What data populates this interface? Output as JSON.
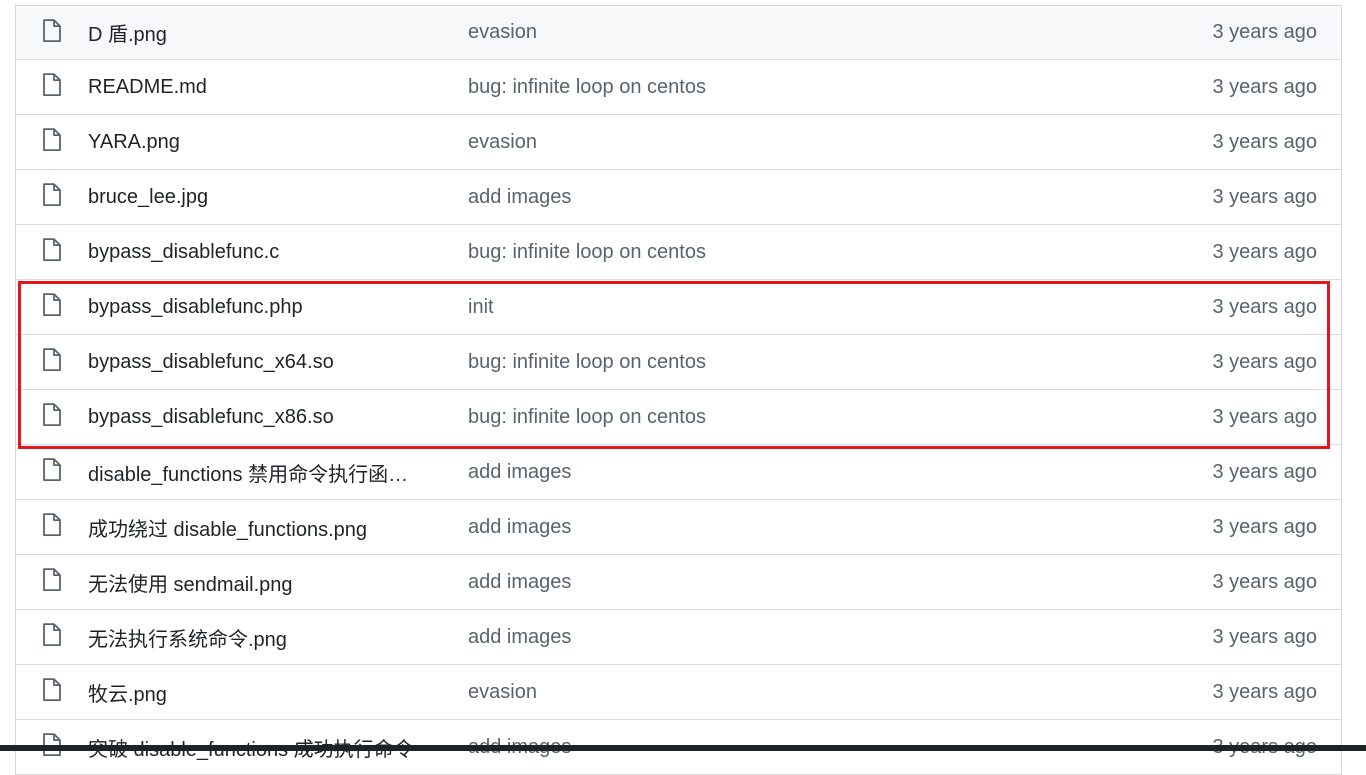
{
  "files": [
    {
      "name": "D 盾.png",
      "message": "evasion",
      "age": "3 years ago"
    },
    {
      "name": "README.md",
      "message": "bug: infinite loop on centos",
      "age": "3 years ago"
    },
    {
      "name": "YARA.png",
      "message": "evasion",
      "age": "3 years ago"
    },
    {
      "name": "bruce_lee.jpg",
      "message": "add images",
      "age": "3 years ago"
    },
    {
      "name": "bypass_disablefunc.c",
      "message": "bug: infinite loop on centos",
      "age": "3 years ago"
    },
    {
      "name": "bypass_disablefunc.php",
      "message": "init",
      "age": "3 years ago"
    },
    {
      "name": "bypass_disablefunc_x64.so",
      "message": "bug: infinite loop on centos",
      "age": "3 years ago"
    },
    {
      "name": "bypass_disablefunc_x86.so",
      "message": "bug: infinite loop on centos",
      "age": "3 years ago"
    },
    {
      "name": "disable_functions 禁用命令执行函…",
      "message": "add images",
      "age": "3 years ago"
    },
    {
      "name": "成功绕过 disable_functions.png",
      "message": "add images",
      "age": "3 years ago"
    },
    {
      "name": "无法使用 sendmail.png",
      "message": "add images",
      "age": "3 years ago"
    },
    {
      "name": "无法执行系统命令.png",
      "message": "add images",
      "age": "3 years ago"
    },
    {
      "name": "牧云.png",
      "message": "evasion",
      "age": "3 years ago"
    },
    {
      "name": "突破 disable_functions 成功执行命令",
      "message": "add images",
      "age": "3 years ago"
    }
  ],
  "colors": {
    "highlight": "#e8131b",
    "text": "#1f2328",
    "muted": "#59636e",
    "border": "#d8dee4"
  },
  "icons": {
    "file": "file-icon"
  }
}
